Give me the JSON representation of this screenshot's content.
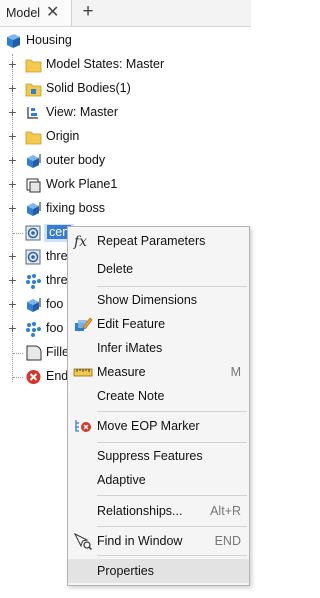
{
  "tabs": {
    "active_label": "Model",
    "close_glyph": "✕",
    "add_glyph": "+"
  },
  "tree": {
    "root": {
      "label": "Housing",
      "icon": "part-cube-icon"
    },
    "items": [
      {
        "label": "Model States: Master",
        "icon": "folder-icon"
      },
      {
        "label": "Solid Bodies(1)",
        "icon": "solid-bodies-folder-icon"
      },
      {
        "label": "View: Master",
        "icon": "view-icon"
      },
      {
        "label": "Origin",
        "icon": "folder-icon"
      },
      {
        "label": "outer body",
        "icon": "extrude-feature-icon"
      },
      {
        "label": "Work Plane1",
        "icon": "work-plane-icon"
      },
      {
        "label": "fixing boss",
        "icon": "extrude-feature-icon"
      },
      {
        "label": "cen",
        "icon": "hole-feature-icon",
        "selected": true
      },
      {
        "label": "thre",
        "icon": "hole-feature-icon"
      },
      {
        "label": "thre",
        "icon": "pattern-icon"
      },
      {
        "label": "foo",
        "icon": "extrude-feature-icon"
      },
      {
        "label": "foo",
        "icon": "pattern-icon"
      },
      {
        "label": "Fille",
        "icon": "fillet-icon"
      },
      {
        "label": "End",
        "icon": "end-of-part-icon"
      }
    ]
  },
  "context_menu": {
    "items": [
      {
        "label": "Repeat Parameters",
        "icon": "fx-icon",
        "shortcut": ""
      },
      {
        "label": "Delete",
        "icon": "",
        "shortcut": ""
      },
      {
        "label": "Show Dimensions",
        "icon": "",
        "shortcut": ""
      },
      {
        "label": "Edit Feature",
        "icon": "edit-feature-icon",
        "shortcut": ""
      },
      {
        "label": "Infer iMates",
        "icon": "",
        "shortcut": ""
      },
      {
        "label": "Measure",
        "icon": "ruler-icon",
        "shortcut": "M"
      },
      {
        "label": "Create Note",
        "icon": "",
        "shortcut": ""
      },
      {
        "label": "Move EOP Marker",
        "icon": "move-eop-marker-icon",
        "shortcut": ""
      },
      {
        "label": "Suppress Features",
        "icon": "",
        "shortcut": ""
      },
      {
        "label": "Adaptive",
        "icon": "",
        "shortcut": ""
      },
      {
        "label": "Relationships...",
        "icon": "",
        "shortcut": "Alt+R"
      },
      {
        "label": "Find in Window",
        "icon": "find-in-window-icon",
        "shortcut": "END"
      },
      {
        "label": "Properties",
        "icon": "",
        "shortcut": ""
      }
    ]
  },
  "colors": {
    "folder": "#f2c94c",
    "feature_blue": "#2f7fd6",
    "selection": "#cfe3f8",
    "menu_bg": "#f5f5f5",
    "menu_hover": "#e3e3e3",
    "end_red": "#d9342b"
  }
}
